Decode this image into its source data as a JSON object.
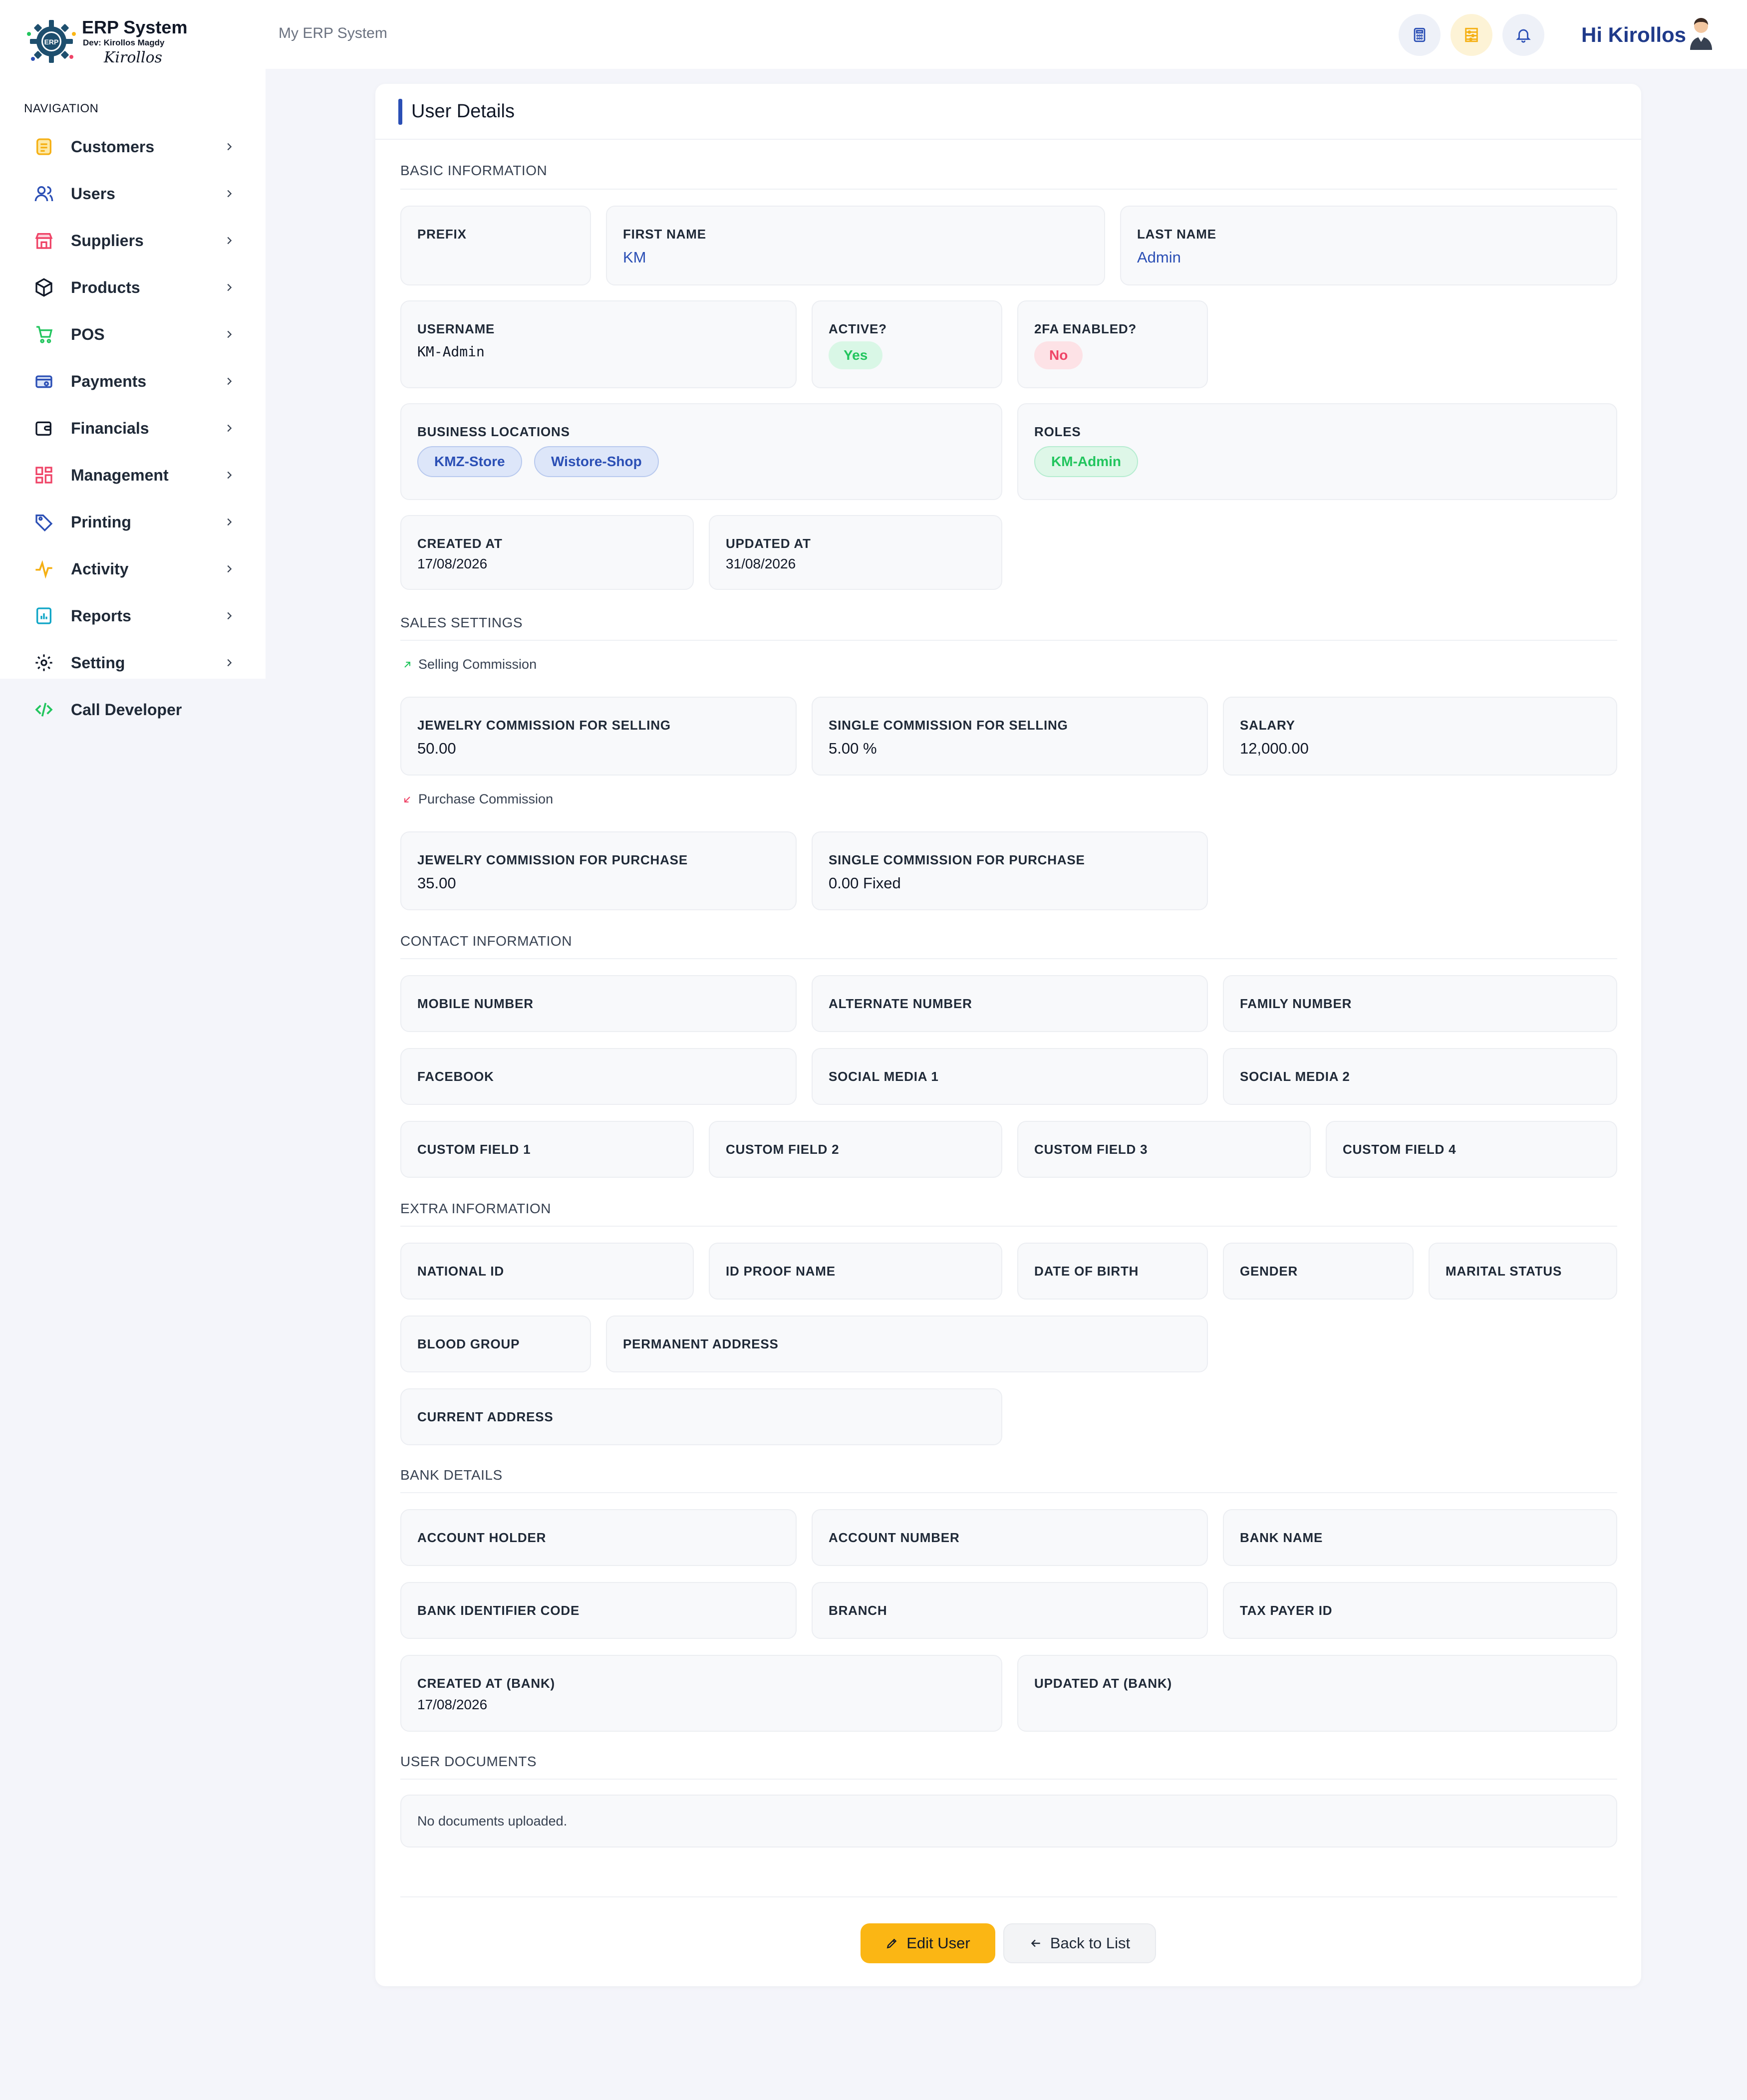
{
  "brand": {
    "title": "ERP System",
    "dev_line": "Dev: Kirollos Magdy",
    "signature": "Kirollos",
    "gear_text": "ERP",
    "colors": {
      "primary": "#2b4fb5",
      "accent_yellow": "#fbb614",
      "success": "#22c55e",
      "danger": "#ef4467"
    }
  },
  "sidebar": {
    "heading": "NAVIGATION",
    "items": [
      {
        "label": "Customers",
        "icon": "customers-icon"
      },
      {
        "label": "Users",
        "icon": "users-icon"
      },
      {
        "label": "Suppliers",
        "icon": "store-icon"
      },
      {
        "label": "Products",
        "icon": "box-icon"
      },
      {
        "label": "POS",
        "icon": "cart-icon"
      },
      {
        "label": "Payments",
        "icon": "payment-icon"
      },
      {
        "label": "Financials",
        "icon": "wallet-icon"
      },
      {
        "label": "Management",
        "icon": "grid-icon"
      },
      {
        "label": "Printing",
        "icon": "tag-icon"
      },
      {
        "label": "Activity",
        "icon": "activity-icon"
      },
      {
        "label": "Reports",
        "icon": "report-icon"
      },
      {
        "label": "Setting",
        "icon": "gear-icon"
      },
      {
        "label": "Call Developer",
        "icon": "code-icon"
      }
    ]
  },
  "topbar": {
    "title": "My ERP System",
    "greeting": "Hi Kirollos",
    "buttons": [
      "calculator-icon",
      "abacus-icon",
      "bell-icon"
    ]
  },
  "card": {
    "title": "User Details"
  },
  "basic": {
    "section": "BASIC INFORMATION",
    "prefix_label": "PREFIX",
    "prefix_value": "",
    "first_name_label": "FIRST NAME",
    "first_name_value": "KM",
    "last_name_label": "LAST NAME",
    "last_name_value": "Admin",
    "username_label": "USERNAME",
    "username_value": "KM-Admin",
    "active_label": "ACTIVE?",
    "active_value": "Yes",
    "twofa_label": "2FA ENABLED?",
    "twofa_value": "No",
    "locations_label": "BUSINESS LOCATIONS",
    "locations": [
      "KMZ-Store",
      "Wistore-Shop"
    ],
    "roles_label": "ROLES",
    "roles": [
      "KM-Admin"
    ],
    "created_label": "CREATED AT",
    "created_value": "17/08/2026",
    "updated_label": "UPDATED AT",
    "updated_value": "31/08/2026"
  },
  "sales": {
    "section": "SALES SETTINGS",
    "selling_title": "Selling Commission",
    "jewelry_selling_label": "JEWELRY COMMISSION FOR SELLING",
    "jewelry_selling_value": "50.00",
    "single_selling_label": "SINGLE COMMISSION FOR SELLING",
    "single_selling_value": "5.00 %",
    "salary_label": "SALARY",
    "salary_value": "12,000.00",
    "purchase_title": "Purchase Commission",
    "jewelry_purchase_label": "JEWELRY COMMISSION FOR PURCHASE",
    "jewelry_purchase_value": "35.00",
    "single_purchase_label": "SINGLE COMMISSION FOR PURCHASE",
    "single_purchase_value": "0.00 Fixed"
  },
  "contact": {
    "section": "CONTACT INFORMATION",
    "mobile": "MOBILE NUMBER",
    "alternate": "ALTERNATE NUMBER",
    "family": "FAMILY NUMBER",
    "facebook": "FACEBOOK",
    "social1": "SOCIAL MEDIA 1",
    "social2": "SOCIAL MEDIA 2",
    "custom1": "CUSTOM FIELD 1",
    "custom2": "CUSTOM FIELD 2",
    "custom3": "CUSTOM FIELD 3",
    "custom4": "CUSTOM FIELD 4"
  },
  "extra": {
    "section": "EXTRA INFORMATION",
    "national_id": "NATIONAL ID",
    "id_proof": "ID PROOF NAME",
    "dob": "DATE OF BIRTH",
    "gender": "GENDER",
    "marital": "MARITAL STATUS",
    "blood": "BLOOD GROUP",
    "permanent": "PERMANENT ADDRESS",
    "current": "CURRENT ADDRESS"
  },
  "bank": {
    "section": "BANK DETAILS",
    "holder": "ACCOUNT HOLDER",
    "number": "ACCOUNT NUMBER",
    "name": "BANK NAME",
    "bic": "BANK IDENTIFIER CODE",
    "branch": "BRANCH",
    "tax": "TAX PAYER ID",
    "created_label": "CREATED AT (BANK)",
    "created_value": "17/08/2026",
    "updated_label": "UPDATED AT (BANK)",
    "updated_value": ""
  },
  "documents": {
    "section": "USER DOCUMENTS",
    "empty": "No documents uploaded."
  },
  "actions": {
    "edit": "Edit User",
    "back": "Back to List"
  }
}
